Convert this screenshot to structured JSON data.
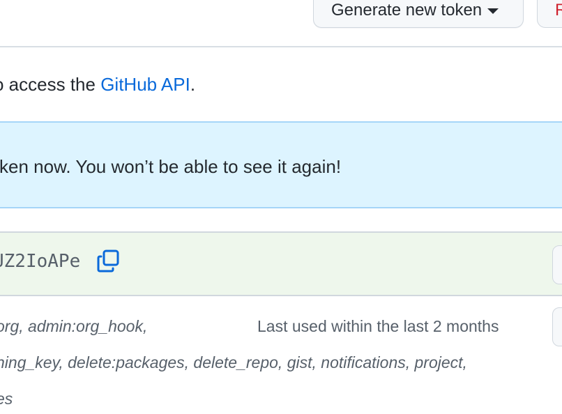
{
  "header": {
    "generate_button": "Generate new token",
    "revoke_button": "R"
  },
  "intro": {
    "prefix": "o access the ",
    "link": "GitHub API",
    "suffix": "."
  },
  "flash": {
    "message": "ken now. You won’t be able to see it again!"
  },
  "new_token": {
    "value": "UZ2IoAPe",
    "copy_icon": "copy-icon"
  },
  "existing_token": {
    "scopes_line_1": "org, admin:org_hook,",
    "scopes_line_2": "ning_key, delete:packages, delete_repo, gist, notifications, project,",
    "scopes_line_3": "es",
    "last_used": "Last used within the last 2 months"
  },
  "colors": {
    "link": "#0969da",
    "flash_bg": "#ddf4ff",
    "flash_border": "#a5d5f8",
    "token_bg": "#eef7ec",
    "danger": "#cf222e"
  }
}
